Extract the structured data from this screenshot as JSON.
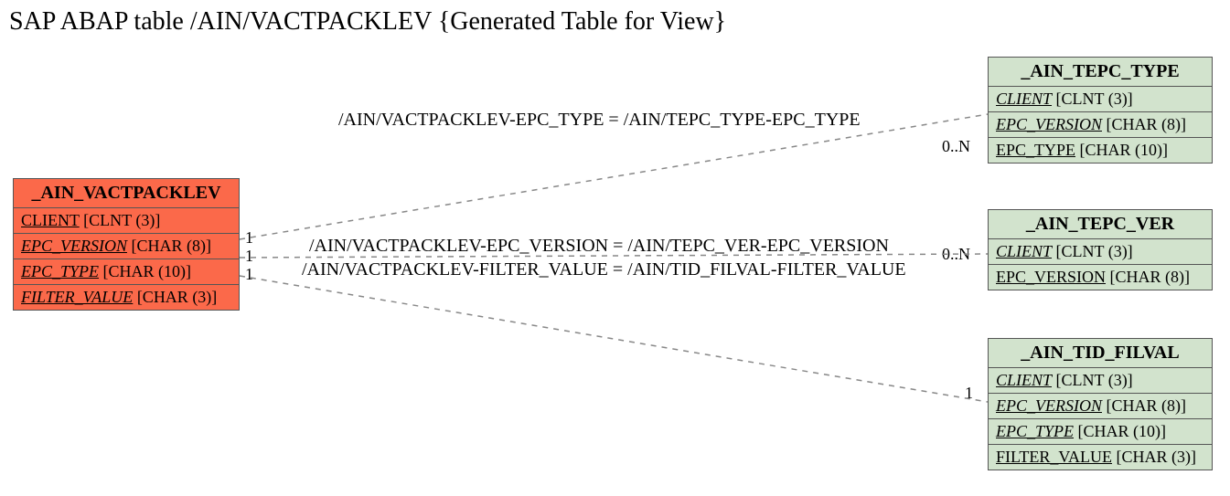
{
  "title": "SAP ABAP table /AIN/VACTPACKLEV {Generated Table for View}",
  "main": {
    "name": "_AIN_VACTPACKLEV",
    "fields": [
      {
        "label": "CLIENT",
        "type": "[CLNT (3)]",
        "underline": true,
        "italic": false
      },
      {
        "label": "EPC_VERSION",
        "type": "[CHAR (8)]",
        "underline": true,
        "italic": true
      },
      {
        "label": "EPC_TYPE",
        "type": "[CHAR (10)]",
        "underline": true,
        "italic": true
      },
      {
        "label": "FILTER_VALUE",
        "type": "[CHAR (3)]",
        "underline": true,
        "italic": true
      }
    ]
  },
  "rel": [
    {
      "label": "/AIN/VACTPACKLEV-EPC_TYPE = /AIN/TEPC_TYPE-EPC_TYPE",
      "leftCard": "1",
      "rightCard": "0..N",
      "target": {
        "name": "_AIN_TEPC_TYPE",
        "fields": [
          {
            "label": "CLIENT",
            "type": "[CLNT (3)]",
            "underline": true,
            "italic": true
          },
          {
            "label": "EPC_VERSION",
            "type": "[CHAR (8)]",
            "underline": true,
            "italic": true
          },
          {
            "label": "EPC_TYPE",
            "type": "[CHAR (10)]",
            "underline": true,
            "italic": false
          }
        ]
      }
    },
    {
      "label": "/AIN/VACTPACKLEV-EPC_VERSION = /AIN/TEPC_VER-EPC_VERSION",
      "leftCard": "1",
      "rightCard": "0..N",
      "target": {
        "name": "_AIN_TEPC_VER",
        "fields": [
          {
            "label": "CLIENT",
            "type": "[CLNT (3)]",
            "underline": true,
            "italic": true
          },
          {
            "label": "EPC_VERSION",
            "type": "[CHAR (8)]",
            "underline": true,
            "italic": false
          }
        ]
      }
    },
    {
      "label": "/AIN/VACTPACKLEV-FILTER_VALUE = /AIN/TID_FILVAL-FILTER_VALUE",
      "leftCard": "1",
      "rightCard": "1",
      "target": {
        "name": "_AIN_TID_FILVAL",
        "fields": [
          {
            "label": "CLIENT",
            "type": "[CLNT (3)]",
            "underline": true,
            "italic": true
          },
          {
            "label": "EPC_VERSION",
            "type": "[CHAR (8)]",
            "underline": true,
            "italic": true
          },
          {
            "label": "EPC_TYPE",
            "type": "[CHAR (10)]",
            "underline": true,
            "italic": true
          },
          {
            "label": "FILTER_VALUE",
            "type": "[CHAR (3)]",
            "underline": true,
            "italic": false
          }
        ]
      }
    }
  ]
}
